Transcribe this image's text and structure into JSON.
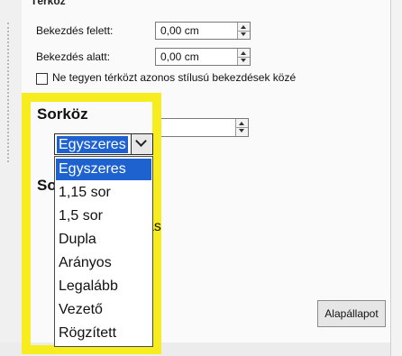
{
  "section_top_label": "Térköz",
  "spacing": {
    "above_label": "Bekezdés felett:",
    "above_value": "0,00 cm",
    "below_label": "Bekezdés alatt:",
    "below_value": "0,00 cm",
    "no_space_label": "Ne tegyen térközt azonos stílusú bekezdések közé"
  },
  "line_spacing": {
    "title": "Sorköz",
    "selected": "Egyszeres",
    "options": [
      "Egyszeres",
      "1,15 sor",
      "1,5 sor",
      "Dupla",
      "Arányos",
      "Legalább",
      "Vezető",
      "Rögzített"
    ]
  },
  "partial_texts": {
    "title2_fragment": "So",
    "row_fragment": "ás"
  },
  "buttons": {
    "reset": "Alapállapot"
  },
  "colors": {
    "highlight": "#f7ec1e",
    "selection": "#1e62d0"
  }
}
